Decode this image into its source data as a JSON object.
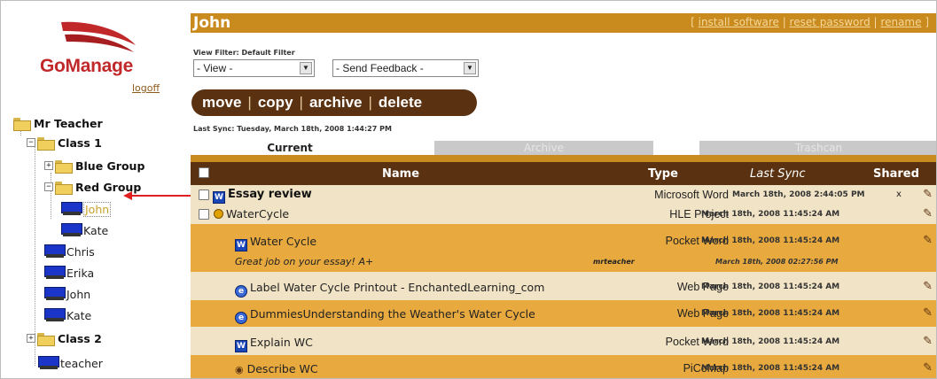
{
  "app": {
    "brand": "GoManage",
    "logoff_label": "logoff"
  },
  "tree": {
    "root": "Mr Teacher",
    "class1": "Class 1",
    "blue_group": "Blue Group",
    "red_group": "Red Group",
    "red_members": [
      "John",
      "Kate"
    ],
    "class1_students": [
      "Chris",
      "Erika",
      "John",
      "Kate"
    ],
    "class2": "Class 2",
    "teacher": "teacher"
  },
  "header": {
    "title": "John",
    "links": [
      "install software",
      "reset password",
      "rename"
    ]
  },
  "filters": {
    "label": "View Filter: Default Filter",
    "view_value": "- View -",
    "feedback_value": "- Send Feedback -"
  },
  "actions": [
    "move",
    "copy",
    "archive",
    "delete"
  ],
  "last_sync": "Last Sync: Tuesday, March 18th, 2008 1:44:27 PM",
  "tabs": [
    "Current",
    "Archive",
    "Trashcan"
  ],
  "columns": {
    "name": "Name",
    "type": "Type",
    "last_sync": "Last Sync",
    "shared": "Shared"
  },
  "rows": [
    {
      "name": "Essay review",
      "type": "Microsoft Word",
      "sync": "March 18th, 2008 2:44:05 PM",
      "shared": "x"
    },
    {
      "name": "WaterCycle",
      "type": "HLE Project",
      "sync": "March 18th, 2008 11:45:24 AM"
    },
    {
      "name": "Water Cycle",
      "type": "Pocket Word",
      "sync": "March 18th, 2008 11:45:24 AM"
    },
    {
      "name": "Great job on your essay! A+",
      "type": "mrteacher",
      "sync": "March 18th, 2008 02:27:56 PM"
    },
    {
      "name": "Label Water Cycle Printout - EnchantedLearning_com",
      "type": "Web Page",
      "sync": "March 18th, 2008 11:45:24 AM"
    },
    {
      "name": "DummiesUnderstanding the Weather's Water Cycle",
      "type": "Web Page",
      "sync": "March 18th, 2008 11:45:24 AM"
    },
    {
      "name": "Explain WC",
      "type": "Pocket Word",
      "sync": "March 18th, 2008 11:45:24 AM"
    },
    {
      "name": "Describe WC",
      "type": "PiCoMap",
      "sync": "March 18th, 2008 11:45:24 AM"
    }
  ],
  "colors": {
    "accent": "#c98a1e",
    "dark": "#5a3211",
    "row_light": "#f1e3c5",
    "row_gold": "#e8a93e",
    "brand_red": "#c0282a"
  }
}
